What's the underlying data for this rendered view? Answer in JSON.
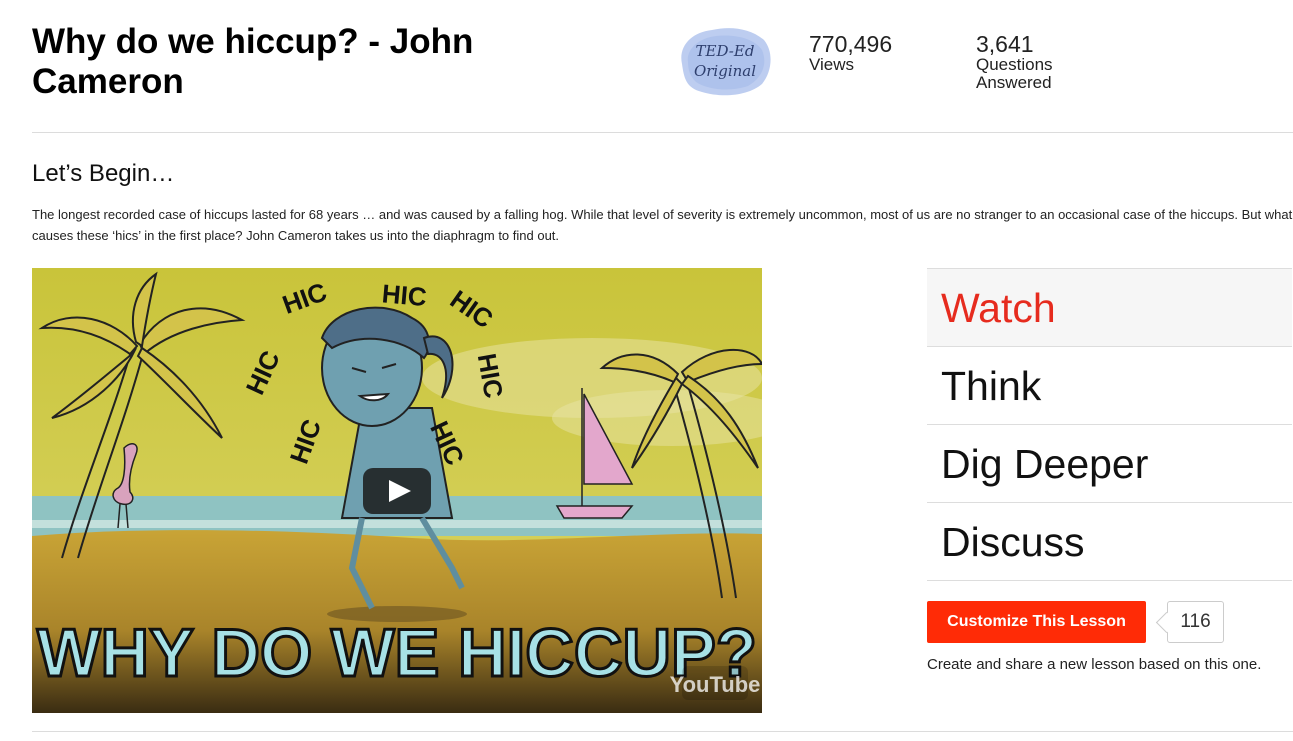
{
  "lesson": {
    "title": "Why do we hiccup? - John Cameron",
    "badge_line1": "TED-Ed",
    "badge_line2": "Original"
  },
  "stats": {
    "views_value": "770,496",
    "views_label": "Views",
    "questions_value": "3,641",
    "questions_label_line1": "Questions",
    "questions_label_line2": "Answered"
  },
  "intro": {
    "heading": "Let’s Begin…",
    "text": "The longest recorded case of hiccups lasted for 68 years … and was caused by a falling hog. While that level of severity is extremely uncommon, most of us are no stranger to an occasional case of the hiccups. But what causes these ‘hics’ in the first place? John Cameron takes us into the diaphragm to find out."
  },
  "video": {
    "title_text": "WHY DO WE HICCUP?",
    "hic_text": "HIC",
    "youtube_label": "YouTube"
  },
  "menu": {
    "items": [
      {
        "label": "Watch",
        "active": true
      },
      {
        "label": "Think",
        "active": false
      },
      {
        "label": "Dig Deeper",
        "active": false
      },
      {
        "label": "Discuss",
        "active": false
      }
    ]
  },
  "customize": {
    "button_label": "Customize This Lesson",
    "count": "116",
    "note": "Create and share a new lesson based on this one."
  },
  "colors": {
    "accent": "#e62b1e",
    "button": "#ff2b06"
  }
}
